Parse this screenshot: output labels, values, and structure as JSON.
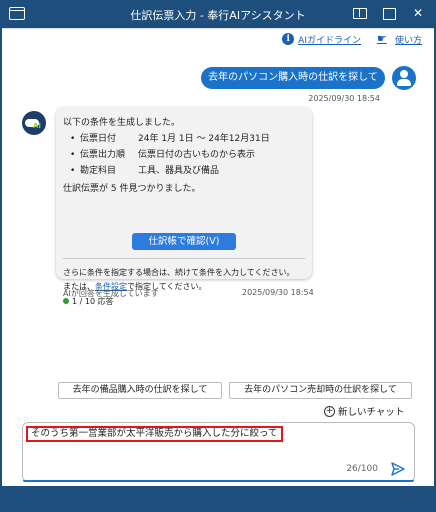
{
  "window": {
    "title": "仕訳伝票入力 - 奉行AIアシスタント"
  },
  "toplinks": {
    "guide": "AIガイドライン",
    "howto": "使い方"
  },
  "user_message": {
    "text": "去年のパソコン購入時の仕訳を探して",
    "time": "2025/09/30 18:54"
  },
  "ai_message": {
    "intro": "以下の条件を生成しました。",
    "conditions": [
      {
        "key": "伝票日付",
        "value": "24年 1月 1日 ～ 24年12月31日"
      },
      {
        "key": "伝票出力順",
        "value": "伝票日付の古いものから表示"
      },
      {
        "key": "勘定科目",
        "value": "工具、器具及び備品"
      }
    ],
    "bullet": "•",
    "result": "仕訳伝票が 5 件見つかりました。",
    "confirm_button": "仕訳帳で確認(V)",
    "note1": "さらに条件を指定する場合は、続けて条件を入力してください。",
    "note2_prefix": "または、",
    "note2_link": "条件設定",
    "note2_suffix": "で指定してください。",
    "response_count": "1 / 10 応答",
    "status": "AIが回答を生成しています",
    "time": "2025/09/30 18:54"
  },
  "suggestions": [
    "去年の備品購入時の仕訳を探して",
    "去年のパソコン売却時の仕訳を探して"
  ],
  "new_chat": "新しいチャット",
  "input": {
    "value": "そのうち第一営業部が太平洋販売から購入した分に絞って",
    "count": "26/100"
  },
  "colors": {
    "accent": "#1a73c9",
    "titlebar": "#1e4f7c",
    "highlight": "#e01818"
  }
}
